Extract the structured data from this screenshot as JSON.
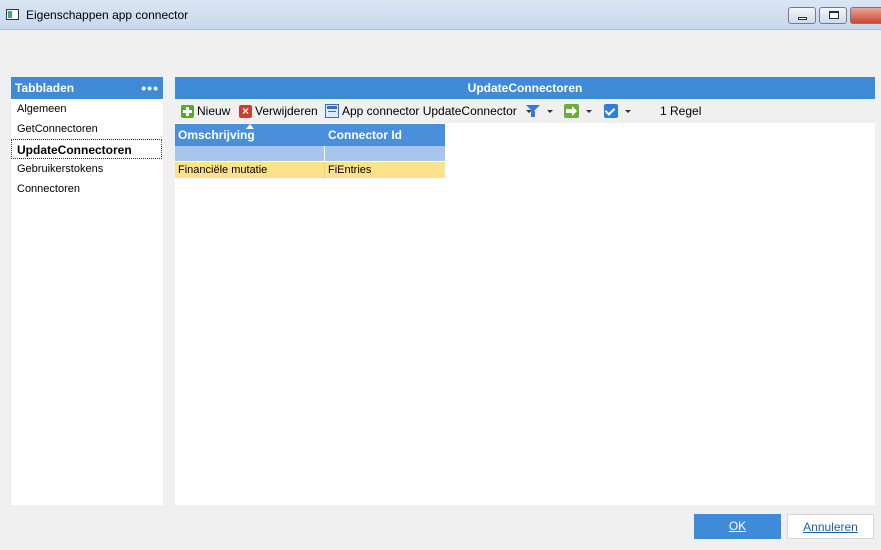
{
  "window": {
    "title": "Eigenschappen app connector"
  },
  "sidebar": {
    "header": "Tabbladen",
    "more": "•••",
    "items": [
      {
        "label": "Algemeen"
      },
      {
        "label": "GetConnectoren"
      },
      {
        "label": "UpdateConnectoren"
      },
      {
        "label": "Gebruikerstokens"
      },
      {
        "label": "Connectoren"
      }
    ],
    "active_index": 2
  },
  "main": {
    "header": "UpdateConnectoren",
    "toolbar": {
      "new_label": "Nieuw",
      "delete_label": "Verwijderen",
      "connector_label": "App connector UpdateConnector",
      "row_count": "1 Regel"
    },
    "grid": {
      "columns": [
        "Omschrijving",
        "Connector Id"
      ],
      "rows": [
        [
          "Financiële mutatie",
          "FiEntries"
        ]
      ]
    }
  },
  "footer": {
    "ok_label": "OK",
    "cancel_label": "Annuleren"
  }
}
